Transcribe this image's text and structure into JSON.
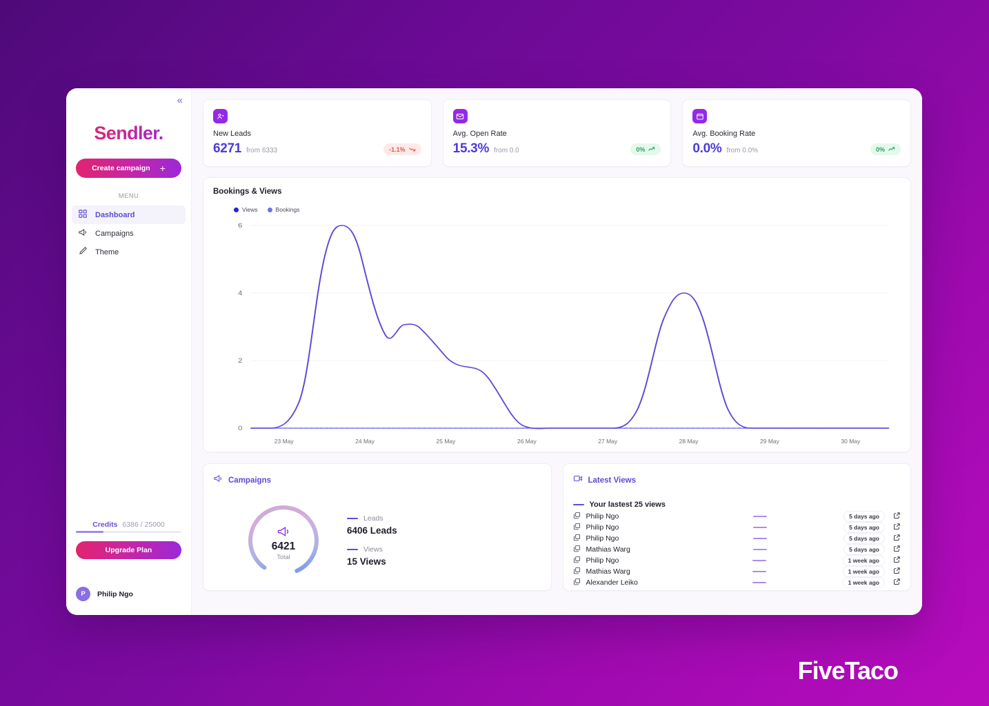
{
  "brand": {
    "name": "Sendler."
  },
  "sidebar": {
    "collapse_icon": "chevron-double-left-icon",
    "create_button": {
      "label": "Create campaign",
      "icon": "plus-icon"
    },
    "menu_heading": "MENU",
    "items": [
      {
        "label": "Dashboard",
        "icon": "grid-icon",
        "active": true
      },
      {
        "label": "Campaigns",
        "icon": "megaphone-icon",
        "active": false
      },
      {
        "label": "Theme",
        "icon": "brush-icon",
        "active": false
      }
    ],
    "credits": {
      "label": "Credits",
      "value": "6386 / 25000",
      "used": 6386,
      "total": 25000
    },
    "upgrade_button": "Upgrade Plan",
    "user": {
      "initial": "P",
      "name": "Philip Ngo"
    }
  },
  "stats": [
    {
      "icon": "user-plus-icon",
      "title": "New Leads",
      "value": "6271",
      "from": "from 6333",
      "badge": "-1.1%",
      "badge_dir": "down",
      "badge_color": "#e2574c"
    },
    {
      "icon": "envelope-icon",
      "title": "Avg. Open Rate",
      "value": "15.3%",
      "from": "from 0.0",
      "badge": "0%",
      "badge_dir": "up",
      "badge_color": "#2f9e63"
    },
    {
      "icon": "calendar-icon",
      "title": "Avg. Booking Rate",
      "value": "0.0%",
      "from": "from 0.0%",
      "badge": "0%",
      "badge_dir": "up",
      "badge_color": "#2f9e63"
    }
  ],
  "chart_card": {
    "title": "Bookings & Views"
  },
  "chart_data": {
    "type": "line",
    "title": "Bookings & Views",
    "xlabel": "",
    "ylabel": "",
    "grid": true,
    "legend_position": "top-left",
    "ylim": [
      0,
      6
    ],
    "yticks": [
      0,
      2,
      4,
      6
    ],
    "categories": [
      "23 May",
      "24 May",
      "25 May",
      "26 May",
      "27 May",
      "28 May",
      "29 May",
      "30 May"
    ],
    "series": [
      {
        "name": "Views",
        "color": "#2323dd",
        "values": [
          0,
          6,
          3,
          2,
          0,
          0,
          4,
          0
        ]
      },
      {
        "name": "Bookings",
        "color": "#6f6ff0",
        "values": [
          0,
          0,
          0,
          0,
          0,
          0,
          0,
          0
        ]
      }
    ]
  },
  "campaigns_panel": {
    "icon": "megaphone-icon",
    "title": "Campaigns",
    "donut": {
      "center_value": "6421",
      "center_label": "Total",
      "icon": "megaphone-icon"
    },
    "legend": [
      {
        "label": "Leads",
        "value": "6406 Leads",
        "color": "#5b4bd6"
      },
      {
        "label": "Views",
        "value": "15 Views",
        "color": "#5b4bd6"
      }
    ]
  },
  "latest_views_panel": {
    "icon": "video-icon",
    "title": "Latest Views",
    "subtitle": "Your lastest 25 views",
    "rows": [
      {
        "name": "Philip Ngo",
        "time": "5 days ago"
      },
      {
        "name": "Philip Ngo",
        "time": "5 days ago"
      },
      {
        "name": "Philip Ngo",
        "time": "5 days ago"
      },
      {
        "name": "Mathias Warg",
        "time": "5 days ago"
      },
      {
        "name": "Philip Ngo",
        "time": "1 week ago"
      },
      {
        "name": "Mathias Warg",
        "time": "1 week ago"
      },
      {
        "name": "Alexander Leiko",
        "time": "1 week ago"
      }
    ]
  },
  "watermark": "FiveTaco",
  "colors": {
    "brand_pink": "#e2246f",
    "brand_purple": "#9c28d8",
    "accent_indigo": "#5b4bd6",
    "bg_gradient_start": "#4e0a78",
    "bg_gradient_end": "#b80cbd"
  }
}
